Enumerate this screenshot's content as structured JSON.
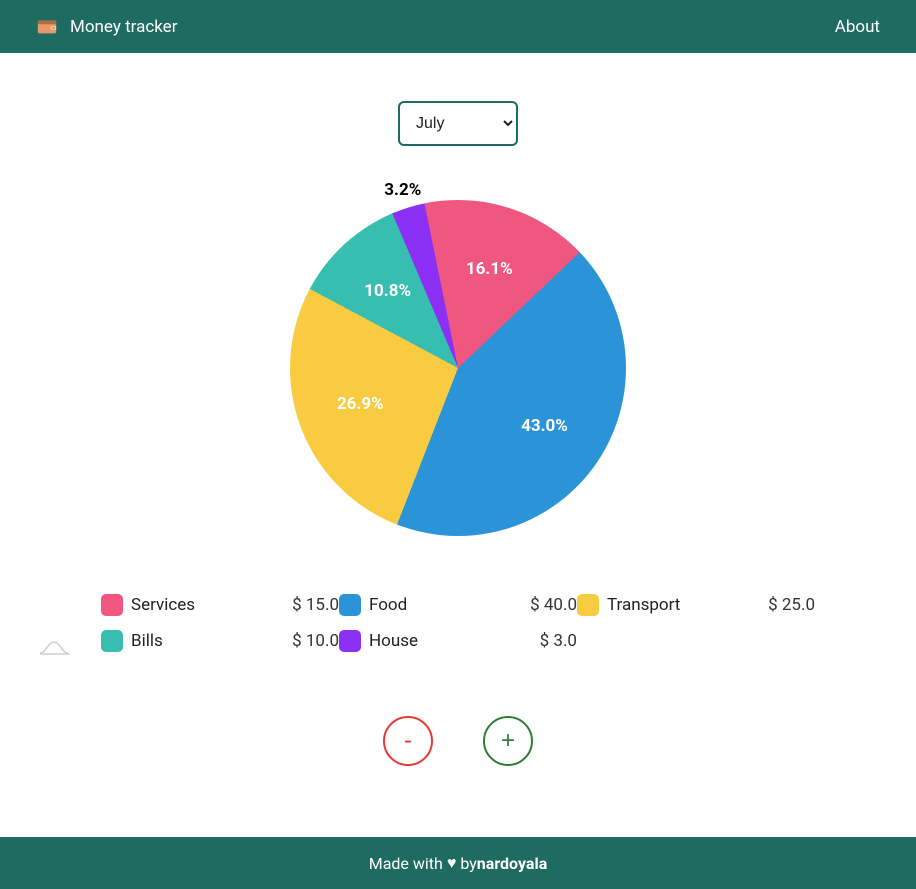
{
  "header": {
    "brand": "Money tracker",
    "nav_about": "About"
  },
  "month_selected": "July",
  "chart_data": {
    "type": "pie",
    "title": "",
    "series": [
      {
        "name": "Services",
        "amount": 15.0,
        "percent": 16.1,
        "color": "#ef5680"
      },
      {
        "name": "Food",
        "amount": 40.0,
        "percent": 43.0,
        "color": "#2b94d8"
      },
      {
        "name": "Transport",
        "amount": 25.0,
        "percent": 26.9,
        "color": "#f9cb40"
      },
      {
        "name": "Bills",
        "amount": 10.0,
        "percent": 10.8,
        "color": "#37beb0"
      },
      {
        "name": "House",
        "amount": 3.0,
        "percent": 3.2,
        "color": "#8c30f5"
      }
    ],
    "start_angle_deg": 348.5
  },
  "legend_rows": [
    [
      {
        "name": "Services",
        "amount": "$ 15.0",
        "color": "#ef5680"
      },
      {
        "name": "Food",
        "amount": "$ 40.0",
        "color": "#2b94d8"
      },
      {
        "name": "Transport",
        "amount": "$ 25.0",
        "color": "#f9cb40"
      }
    ],
    [
      {
        "name": "Bills",
        "amount": "$ 10.0",
        "color": "#37beb0"
      },
      {
        "name": "House",
        "amount": "$ 3.0",
        "color": "#8c30f5"
      }
    ]
  ],
  "actions": {
    "minus": "-",
    "plus": "+"
  },
  "footer": {
    "prefix": "Made with ",
    "heart": "♥",
    "by": " by ",
    "author": "nardoyala"
  }
}
